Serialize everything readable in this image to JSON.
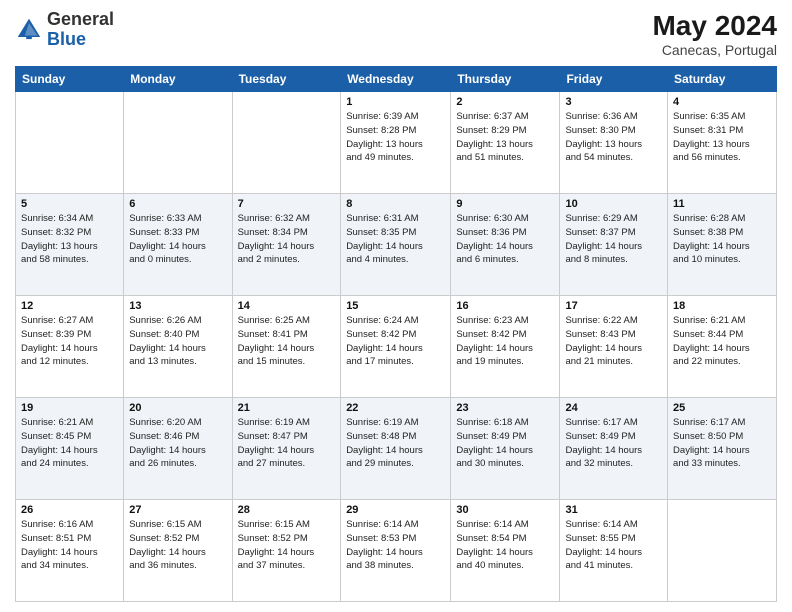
{
  "header": {
    "logo_general": "General",
    "logo_blue": "Blue",
    "month_year": "May 2024",
    "location": "Canecas, Portugal"
  },
  "weekdays": [
    "Sunday",
    "Monday",
    "Tuesday",
    "Wednesday",
    "Thursday",
    "Friday",
    "Saturday"
  ],
  "weeks": [
    [
      {
        "day": "",
        "info": ""
      },
      {
        "day": "",
        "info": ""
      },
      {
        "day": "",
        "info": ""
      },
      {
        "day": "1",
        "info": "Sunrise: 6:39 AM\nSunset: 8:28 PM\nDaylight: 13 hours\nand 49 minutes."
      },
      {
        "day": "2",
        "info": "Sunrise: 6:37 AM\nSunset: 8:29 PM\nDaylight: 13 hours\nand 51 minutes."
      },
      {
        "day": "3",
        "info": "Sunrise: 6:36 AM\nSunset: 8:30 PM\nDaylight: 13 hours\nand 54 minutes."
      },
      {
        "day": "4",
        "info": "Sunrise: 6:35 AM\nSunset: 8:31 PM\nDaylight: 13 hours\nand 56 minutes."
      }
    ],
    [
      {
        "day": "5",
        "info": "Sunrise: 6:34 AM\nSunset: 8:32 PM\nDaylight: 13 hours\nand 58 minutes."
      },
      {
        "day": "6",
        "info": "Sunrise: 6:33 AM\nSunset: 8:33 PM\nDaylight: 14 hours\nand 0 minutes."
      },
      {
        "day": "7",
        "info": "Sunrise: 6:32 AM\nSunset: 8:34 PM\nDaylight: 14 hours\nand 2 minutes."
      },
      {
        "day": "8",
        "info": "Sunrise: 6:31 AM\nSunset: 8:35 PM\nDaylight: 14 hours\nand 4 minutes."
      },
      {
        "day": "9",
        "info": "Sunrise: 6:30 AM\nSunset: 8:36 PM\nDaylight: 14 hours\nand 6 minutes."
      },
      {
        "day": "10",
        "info": "Sunrise: 6:29 AM\nSunset: 8:37 PM\nDaylight: 14 hours\nand 8 minutes."
      },
      {
        "day": "11",
        "info": "Sunrise: 6:28 AM\nSunset: 8:38 PM\nDaylight: 14 hours\nand 10 minutes."
      }
    ],
    [
      {
        "day": "12",
        "info": "Sunrise: 6:27 AM\nSunset: 8:39 PM\nDaylight: 14 hours\nand 12 minutes."
      },
      {
        "day": "13",
        "info": "Sunrise: 6:26 AM\nSunset: 8:40 PM\nDaylight: 14 hours\nand 13 minutes."
      },
      {
        "day": "14",
        "info": "Sunrise: 6:25 AM\nSunset: 8:41 PM\nDaylight: 14 hours\nand 15 minutes."
      },
      {
        "day": "15",
        "info": "Sunrise: 6:24 AM\nSunset: 8:42 PM\nDaylight: 14 hours\nand 17 minutes."
      },
      {
        "day": "16",
        "info": "Sunrise: 6:23 AM\nSunset: 8:42 PM\nDaylight: 14 hours\nand 19 minutes."
      },
      {
        "day": "17",
        "info": "Sunrise: 6:22 AM\nSunset: 8:43 PM\nDaylight: 14 hours\nand 21 minutes."
      },
      {
        "day": "18",
        "info": "Sunrise: 6:21 AM\nSunset: 8:44 PM\nDaylight: 14 hours\nand 22 minutes."
      }
    ],
    [
      {
        "day": "19",
        "info": "Sunrise: 6:21 AM\nSunset: 8:45 PM\nDaylight: 14 hours\nand 24 minutes."
      },
      {
        "day": "20",
        "info": "Sunrise: 6:20 AM\nSunset: 8:46 PM\nDaylight: 14 hours\nand 26 minutes."
      },
      {
        "day": "21",
        "info": "Sunrise: 6:19 AM\nSunset: 8:47 PM\nDaylight: 14 hours\nand 27 minutes."
      },
      {
        "day": "22",
        "info": "Sunrise: 6:19 AM\nSunset: 8:48 PM\nDaylight: 14 hours\nand 29 minutes."
      },
      {
        "day": "23",
        "info": "Sunrise: 6:18 AM\nSunset: 8:49 PM\nDaylight: 14 hours\nand 30 minutes."
      },
      {
        "day": "24",
        "info": "Sunrise: 6:17 AM\nSunset: 8:49 PM\nDaylight: 14 hours\nand 32 minutes."
      },
      {
        "day": "25",
        "info": "Sunrise: 6:17 AM\nSunset: 8:50 PM\nDaylight: 14 hours\nand 33 minutes."
      }
    ],
    [
      {
        "day": "26",
        "info": "Sunrise: 6:16 AM\nSunset: 8:51 PM\nDaylight: 14 hours\nand 34 minutes."
      },
      {
        "day": "27",
        "info": "Sunrise: 6:15 AM\nSunset: 8:52 PM\nDaylight: 14 hours\nand 36 minutes."
      },
      {
        "day": "28",
        "info": "Sunrise: 6:15 AM\nSunset: 8:52 PM\nDaylight: 14 hours\nand 37 minutes."
      },
      {
        "day": "29",
        "info": "Sunrise: 6:14 AM\nSunset: 8:53 PM\nDaylight: 14 hours\nand 38 minutes."
      },
      {
        "day": "30",
        "info": "Sunrise: 6:14 AM\nSunset: 8:54 PM\nDaylight: 14 hours\nand 40 minutes."
      },
      {
        "day": "31",
        "info": "Sunrise: 6:14 AM\nSunset: 8:55 PM\nDaylight: 14 hours\nand 41 minutes."
      },
      {
        "day": "",
        "info": ""
      }
    ]
  ]
}
